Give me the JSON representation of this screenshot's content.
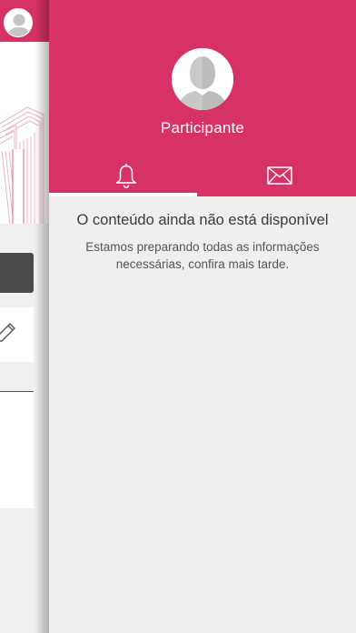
{
  "profile": {
    "name": "Participante"
  },
  "tabs": [
    {
      "icon": "bell-icon",
      "selected": true
    },
    {
      "icon": "envelope-icon",
      "selected": false
    }
  ],
  "empty_state": {
    "title": "O conteúdo ainda não está disponível",
    "message": "Estamos preparando todas as informações necessárias, confira mais tarde."
  },
  "colors": {
    "accent": "#d63265",
    "background": "#efefef",
    "text_primary": "#3a3a3a",
    "text_secondary": "#555555"
  }
}
